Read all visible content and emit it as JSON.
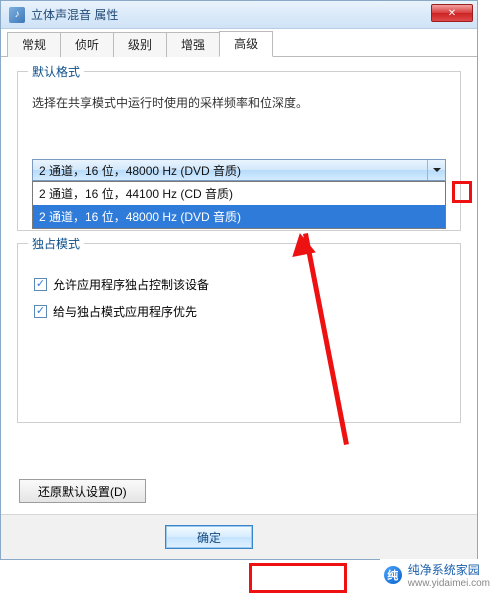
{
  "window": {
    "title": "立体声混音 属性",
    "close_glyph": "✕"
  },
  "tabs": {
    "items": [
      {
        "label": "常规"
      },
      {
        "label": "侦听"
      },
      {
        "label": "级别"
      },
      {
        "label": "增强"
      },
      {
        "label": "高级"
      }
    ],
    "active_index": 4
  },
  "default_format": {
    "group_title": "默认格式",
    "desc": "选择在共享模式中运行时使用的采样频率和位深度。",
    "combo_value": "2 通道，16 位，48000 Hz (DVD 音质)",
    "dropdown": [
      {
        "label": "2 通道，16 位，44100 Hz (CD 音质)",
        "selected": false
      },
      {
        "label": "2 通道，16 位，48000 Hz (DVD 音质)",
        "selected": true
      }
    ]
  },
  "exclusive": {
    "group_title": "独占模式",
    "chk1_label": "允许应用程序独占控制该设备",
    "chk2_label": "给与独占模式应用程序优先"
  },
  "restore_label": "还原默认设置(D)",
  "ok_label": "确定",
  "watermark": {
    "name": "纯净系统家园",
    "url": "www.yidaimei.com"
  }
}
